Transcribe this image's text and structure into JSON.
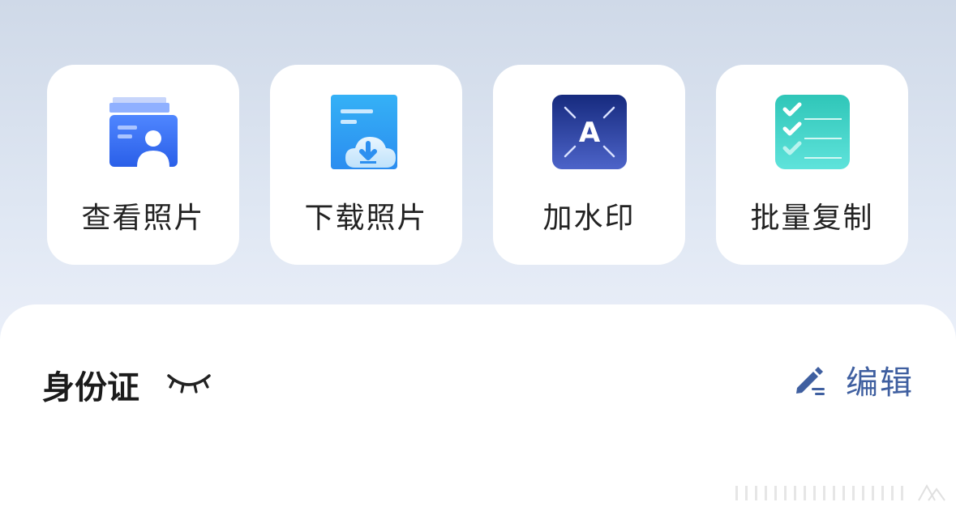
{
  "actions": [
    {
      "label": "查看照片",
      "icon": "id-card-icon"
    },
    {
      "label": "下载照片",
      "icon": "cloud-download-icon"
    },
    {
      "label": "加水印",
      "icon": "watermark-icon"
    },
    {
      "label": "批量复制",
      "icon": "checklist-icon"
    }
  ],
  "card": {
    "title": "身份证",
    "visibility_icon": "eye-closed-icon",
    "edit_label": "编辑",
    "edit_icon": "pencil-icon"
  },
  "colors": {
    "edit_text": "#3f5fa0",
    "id_card_blue": "#2f6bf0",
    "download_blue": "#2c9cf1",
    "watermark_navy": "#1c2f86",
    "checklist_teal": "#3fd3c8"
  }
}
